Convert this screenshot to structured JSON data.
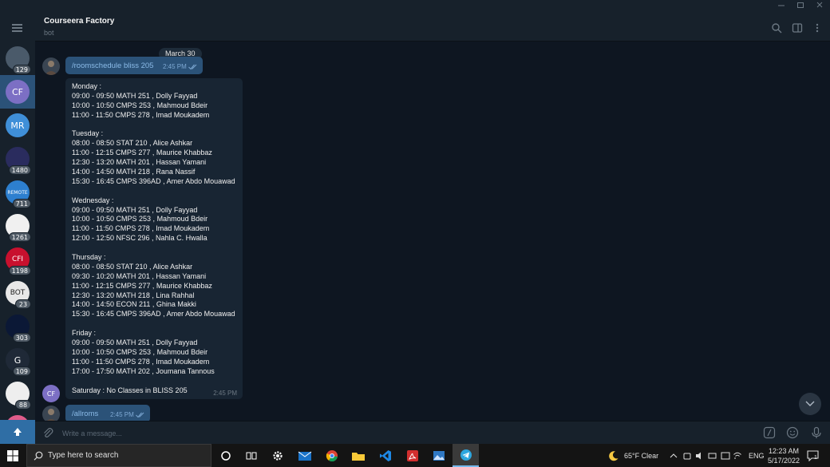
{
  "window": {
    "controls": [
      "minimize",
      "maximize",
      "close"
    ]
  },
  "header": {
    "title": "Courseera Factory",
    "subtitle": "bot"
  },
  "sidebar": {
    "chats": [
      {
        "name": "game-chat",
        "initials": "",
        "color": "#4a5a6a",
        "unread": "129",
        "active": false
      },
      {
        "name": "courseera-factory",
        "initials": "CF",
        "color": "#7c6fc4",
        "unread": "",
        "active": true
      },
      {
        "name": "mr-chat",
        "initials": "MR",
        "color": "#3f8fd8",
        "unread": "",
        "active": false
      },
      {
        "name": "arabic-channel",
        "initials": "",
        "color": "#2a2c5e",
        "unread": "1480",
        "active": false
      },
      {
        "name": "remote-jobs",
        "initials": "REMOTE",
        "color": "#2d7fcf",
        "unread": "711",
        "active": false
      },
      {
        "name": "weather-channel",
        "initials": "",
        "color": "#f0f0f0",
        "unread": "1261",
        "active": false
      },
      {
        "name": "cfi-channel",
        "initials": "CFI",
        "color": "#c8102e",
        "unread": "1198",
        "active": false
      },
      {
        "name": "bot-channel",
        "initials": "BOT",
        "color": "#e8e8e8",
        "unread": "23",
        "active": false
      },
      {
        "name": "cloud-channel",
        "initials": "",
        "color": "#0b1836",
        "unread": "303",
        "active": false
      },
      {
        "name": "g-channel",
        "initials": "G",
        "color": "#1f2937",
        "unread": "109",
        "active": false
      },
      {
        "name": "mascot-channel",
        "initials": "",
        "color": "#eeeeee",
        "unread": "88",
        "active": false
      },
      {
        "name": "pink-channel",
        "initials": "",
        "color": "#e05c8a",
        "unread": "",
        "active": false
      }
    ]
  },
  "messages": {
    "date": "March 30",
    "command1": {
      "text": "/roomschedule bliss 205",
      "time": "2:45 PM"
    },
    "schedule": {
      "lines": [
        "Monday :",
        "09:00 - 09:50  MATH 251  ,  Dolly Fayyad",
        "10:00 - 10:50  CMPS 253  ,  Mahmoud Bdeir",
        "11:00 - 11:50  CMPS 278  ,  Imad Moukadem",
        "",
        "Tuesday :",
        "08:00 - 08:50  STAT 210  ,  Alice Ashkar",
        "11:00 - 12:15  CMPS 277  ,  Maurice Khabbaz",
        "12:30 - 13:20  MATH 201  ,  Hassan Yamani",
        "14:00 - 14:50  MATH 218  ,  Rana Nassif",
        "15:30 - 16:45  CMPS 396AD  ,  Amer Abdo Mouawad",
        "",
        "Wednesday :",
        "09:00 - 09:50  MATH 251  ,  Dolly Fayyad",
        "10:00 - 10:50  CMPS 253  ,  Mahmoud Bdeir",
        "11:00 - 11:50  CMPS 278  ,  Imad Moukadem",
        "12:00 - 12:50  NFSC 296  ,  Nahla C. Hwalla",
        "",
        "Thursday :",
        "08:00 - 08:50  STAT 210  ,  Alice Ashkar",
        "09:30 - 10:20  MATH 201  ,  Hassan Yamani",
        "11:00 - 12:15  CMPS 277  ,  Maurice Khabbaz",
        "12:30 - 13:20  MATH 218  ,  Lina Rahhal",
        "14:00 - 14:50  ECON 211  ,  Ghina Makki",
        "15:30 - 16:45  CMPS 396AD  ,  Amer Abdo Mouawad",
        "",
        "Friday :",
        "09:00 - 09:50  MATH 251  ,  Dolly Fayyad",
        "10:00 - 10:50  CMPS 253  ,  Mahmoud Bdeir",
        "11:00 - 11:50  CMPS 278  ,  Imad Moukadem",
        "17:00 - 17:50  MATH 202  ,  Joumana Tannous",
        "",
        "Saturday : No Classes in BLISS 205"
      ],
      "time": "2:45 PM",
      "sender_initials": "CF"
    },
    "command2": {
      "text": "/allroms",
      "time": "2:45 PM"
    }
  },
  "composer": {
    "placeholder": "Write a message..."
  },
  "taskbar": {
    "search_placeholder": "Type here to search",
    "apps": [
      "cortana",
      "task-view",
      "settings",
      "mail",
      "chrome",
      "file-explorer",
      "vscode",
      "acrobat",
      "photos",
      "telegram"
    ],
    "weather": "65°F  Clear",
    "language": "ENG",
    "time": "12:23 AM",
    "date": "5/17/2022",
    "notification_count": "1"
  },
  "colors": {
    "accent": "#2b5278",
    "bg": "#0e1621",
    "panel": "#17212b",
    "incoming": "#182533"
  }
}
